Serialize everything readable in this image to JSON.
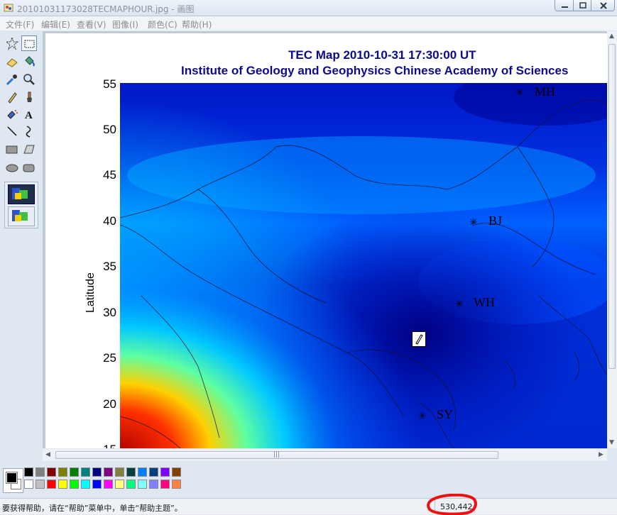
{
  "window": {
    "title": "20101031173028TECMAPHOUR.jpg - 画图"
  },
  "menu": [
    {
      "label": "文件(F)"
    },
    {
      "label": "编辑(E)"
    },
    {
      "label": "查看(V)"
    },
    {
      "label": "图像(I)"
    },
    {
      "label": "颜色(C)"
    },
    {
      "label": "帮助(H)"
    }
  ],
  "tools": [
    {
      "name": "free-form-select",
      "icon": "star-select-icon"
    },
    {
      "name": "rect-select",
      "icon": "rect-select-icon"
    },
    {
      "name": "eraser",
      "icon": "eraser-icon"
    },
    {
      "name": "fill",
      "icon": "paint-bucket-icon"
    },
    {
      "name": "pick-color",
      "icon": "eyedropper-icon"
    },
    {
      "name": "magnifier",
      "icon": "magnifier-icon"
    },
    {
      "name": "pencil",
      "icon": "pencil-icon"
    },
    {
      "name": "brush",
      "icon": "brush-icon"
    },
    {
      "name": "airbrush",
      "icon": "airbrush-icon"
    },
    {
      "name": "text",
      "icon": "text-icon",
      "glyph": "A"
    },
    {
      "name": "line",
      "icon": "line-icon"
    },
    {
      "name": "curve",
      "icon": "curve-icon"
    },
    {
      "name": "rectangle",
      "icon": "rectangle-icon"
    },
    {
      "name": "polygon",
      "icon": "polygon-icon"
    },
    {
      "name": "ellipse",
      "icon": "ellipse-icon"
    },
    {
      "name": "rounded-rectangle",
      "icon": "rounded-rect-icon"
    }
  ],
  "figure": {
    "title_line1": "TEC Map 2010-10-31 17:30:00 UT",
    "title_line2": "Institute of Geology and Geophysics Chinese Academy of Sciences",
    "ylabel": "Latitude",
    "yticks": [
      "55",
      "50",
      "45",
      "40",
      "35",
      "30",
      "25",
      "20",
      "15"
    ],
    "stations": [
      {
        "label": "MH",
        "lat": 53.5
      },
      {
        "label": "BJ",
        "lat": 39.9
      },
      {
        "label": "WH",
        "lat": 30.5
      },
      {
        "label": "SY",
        "lat": 18.3
      }
    ],
    "colors": {
      "title": "#0b0b8c",
      "map_low": "#00007a",
      "map_high": "#ff0000"
    }
  },
  "palette": {
    "foreground": "#000000",
    "background": "#ffffff",
    "top_row": [
      "#000000",
      "#808080",
      "#800000",
      "#808000",
      "#008000",
      "#008080",
      "#000080",
      "#800080",
      "#808040",
      "#004040",
      "#0080ff",
      "#004080",
      "#8000ff",
      "#804000"
    ],
    "bottom_row": [
      "#ffffff",
      "#c0c0c0",
      "#ff0000",
      "#ffff00",
      "#00ff00",
      "#00ffff",
      "#0000ff",
      "#ff00ff",
      "#ffff80",
      "#00ff80",
      "#80ffff",
      "#8080ff",
      "#ff0080",
      "#ff8040"
    ]
  },
  "status": {
    "help_text": "要获得帮助，请在“帮助”菜单中，单击“帮助主题”。",
    "cursor_coords": "530,442"
  }
}
